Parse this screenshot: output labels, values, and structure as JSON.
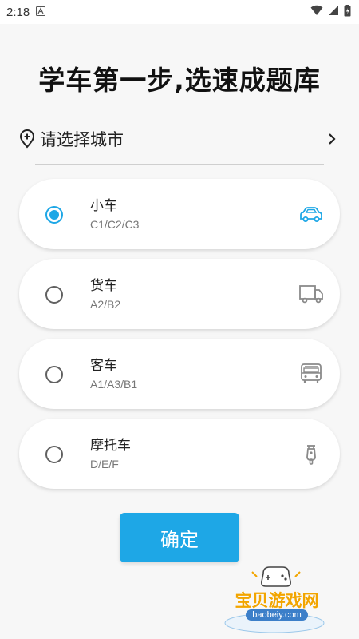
{
  "status_bar": {
    "time": "2:18",
    "notification_icon": "app-a-icon",
    "icons": [
      "wifi-icon",
      "cell-signal-icon",
      "battery-icon"
    ]
  },
  "header": {
    "title": "学车第一步,选速成题库"
  },
  "city": {
    "label": "请选择城市",
    "icon": "location-pin-icon",
    "arrow_icon": "chevron-right-icon"
  },
  "options": [
    {
      "name": "小车",
      "licenses": "C1/C2/C3",
      "selected": true,
      "icon": "car-icon"
    },
    {
      "name": "货车",
      "licenses": "A2/B2",
      "selected": false,
      "icon": "truck-icon"
    },
    {
      "name": "客车",
      "licenses": "A1/A3/B1",
      "selected": false,
      "icon": "bus-icon"
    },
    {
      "name": "摩托车",
      "licenses": "D/E/F",
      "selected": false,
      "icon": "scooter-icon"
    }
  ],
  "confirm_label": "确定",
  "watermark": {
    "text": "宝贝游戏网",
    "url": "baobeiy.com"
  },
  "colors": {
    "accent": "#1ea7e6",
    "background": "#f7f7f7",
    "icon_gray": "#8a8a8a",
    "watermark": "#f2a500"
  }
}
